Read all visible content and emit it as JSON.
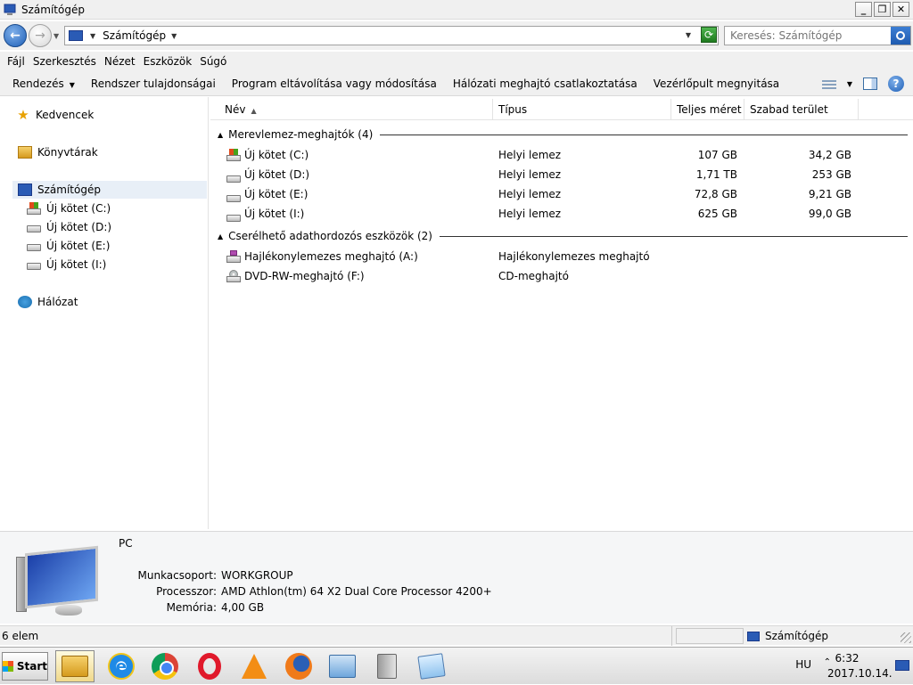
{
  "window": {
    "title": "Számítógép"
  },
  "window_buttons": {
    "minimize": "_",
    "maximize": "❐",
    "close": "✕"
  },
  "address": {
    "crumb": "Számítógép",
    "search_placeholder": "Keresés: Számítógép"
  },
  "menu": [
    "Fájl",
    "Szerkesztés",
    "Nézet",
    "Eszközök",
    "Súgó"
  ],
  "commands": {
    "organize": "Rendezés",
    "items": [
      "Rendszer tulajdonságai",
      "Program eltávolítása vagy módosítása",
      "Hálózati meghajtó csatlakoztatása",
      "Vezérlőpult megnyitása"
    ]
  },
  "sidebar": {
    "favorites": "Kedvencek",
    "libraries": "Könyvtárak",
    "computer": "Számítógép",
    "drives": [
      "Új kötet (C:)",
      "Új kötet (D:)",
      "Új kötet (E:)",
      "Új kötet (I:)"
    ],
    "network": "Hálózat"
  },
  "columns": {
    "name": "Név",
    "type": "Típus",
    "total": "Teljes méret",
    "free": "Szabad terület"
  },
  "groups": {
    "hdd": {
      "label": "Merevlemez-meghajtók (4)",
      "rows": [
        {
          "name": "Új kötet (C:)",
          "type": "Helyi lemez",
          "total": "107 GB",
          "free": "34,2 GB"
        },
        {
          "name": "Új kötet (D:)",
          "type": "Helyi lemez",
          "total": "1,71 TB",
          "free": "253 GB"
        },
        {
          "name": "Új kötet (E:)",
          "type": "Helyi lemez",
          "total": "72,8 GB",
          "free": "9,21 GB"
        },
        {
          "name": "Új kötet (I:)",
          "type": "Helyi lemez",
          "total": "625 GB",
          "free": "99,0 GB"
        }
      ]
    },
    "removable": {
      "label": "Cserélhető adathordozós eszközök (2)",
      "rows": [
        {
          "name": "Hajlékonylemezes meghajtó (A:)",
          "type": "Hajlékonylemezes meghajtó"
        },
        {
          "name": "DVD-RW-meghajtó (F:)",
          "type": "CD-meghajtó"
        }
      ]
    }
  },
  "details": {
    "name": "PC",
    "workgroup_label": "Munkacsoport:",
    "workgroup": "WORKGROUP",
    "processor_label": "Processzor:",
    "processor": "AMD Athlon(tm) 64 X2 Dual Core Processor 4200+",
    "memory_label": "Memória:",
    "memory": "4,00 GB"
  },
  "status": {
    "count": "6 elem",
    "location": "Számítógép"
  },
  "taskbar": {
    "start": "Start",
    "apps": [
      "explorer-icon",
      "internet-explorer-icon",
      "chrome-icon",
      "opera-icon",
      "vlc-icon",
      "firefox-icon",
      "control-panel-icon",
      "address-book-icon",
      "notes-icon"
    ],
    "lang": "HU",
    "time": "6:32",
    "date": "2017.10.14."
  }
}
